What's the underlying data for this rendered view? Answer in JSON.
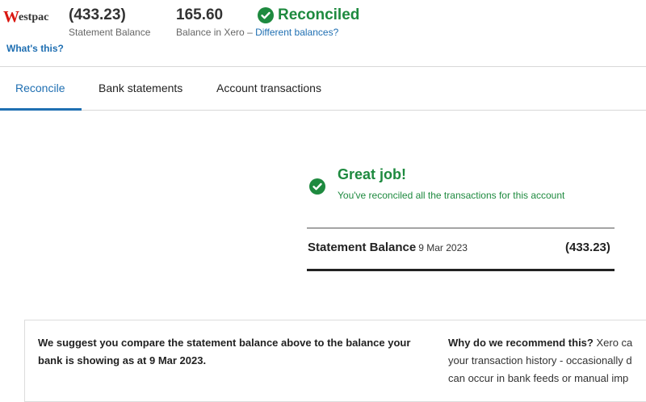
{
  "header": {
    "logo_initial": "W",
    "logo_rest": "estpac",
    "whats_this": "What's this?",
    "statement_balance_value": "(433.23)",
    "statement_balance_label": "Statement Balance",
    "xero_balance_value": "165.60",
    "xero_balance_label": "Balance in Xero",
    "xero_balance_sep": " – ",
    "different_balances_link": "Different balances?",
    "status": "Reconciled"
  },
  "tabs": [
    {
      "label": "Reconcile"
    },
    {
      "label": "Bank statements"
    },
    {
      "label": "Account transactions"
    }
  ],
  "success": {
    "title": "Great job!",
    "subtitle": "You've reconciled all the transactions for this account"
  },
  "statement": {
    "label": "Statement Balance",
    "date": "9 Mar 2023",
    "value": "(433.23)"
  },
  "info": {
    "suggest_text": "We suggest you compare the statement balance above to the balance your bank is showing as at 9 Mar 2023.",
    "why_heading": "Why do we recommend this?",
    "why_line1": " Xero ca",
    "why_line2": "your transaction history - occasionally d",
    "why_line3": "can occur in bank feeds or manual imp"
  },
  "colors": {
    "accent": "#1f6fb2",
    "success": "#1e8a3f",
    "brand": "#da1710"
  }
}
